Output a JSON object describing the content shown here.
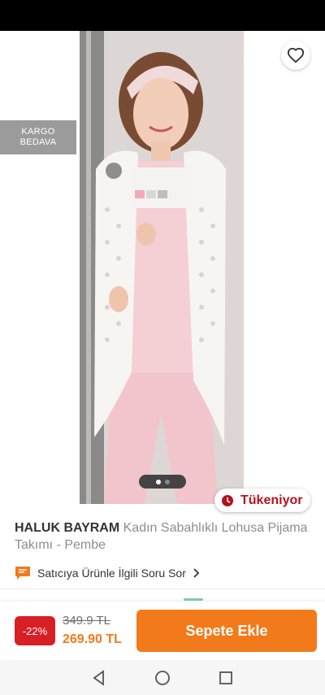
{
  "hero": {
    "cargo_badge": [
      "KARGO",
      "BEDAVA"
    ],
    "carousel": {
      "page_count": 2,
      "active_index": 0
    },
    "stock_label": "Tükeniyor"
  },
  "product": {
    "brand": "HALUK BAYRAM",
    "name": " Kadın  Sabahlıklı Lohusa Pijama Takımı - Pembe",
    "ask_seller": "Satıcıya Ürünle İlgili Soru Sor"
  },
  "bottom_bar": {
    "discount": "-22%",
    "old_price": "349.9 TL",
    "new_price": "269.90 TL",
    "cart_button": "Sepete Ekle"
  },
  "colors": {
    "accent": "#f27a1a",
    "discount_bg": "#d81f26",
    "stock_text": "#b5121b"
  },
  "icons": {
    "back": "arrow-left",
    "share": "share",
    "favorite": "heart-outline",
    "stock": "clock",
    "ask": "chat-bubble",
    "nav": [
      "back-triangle",
      "home-circle",
      "recents-square"
    ]
  }
}
